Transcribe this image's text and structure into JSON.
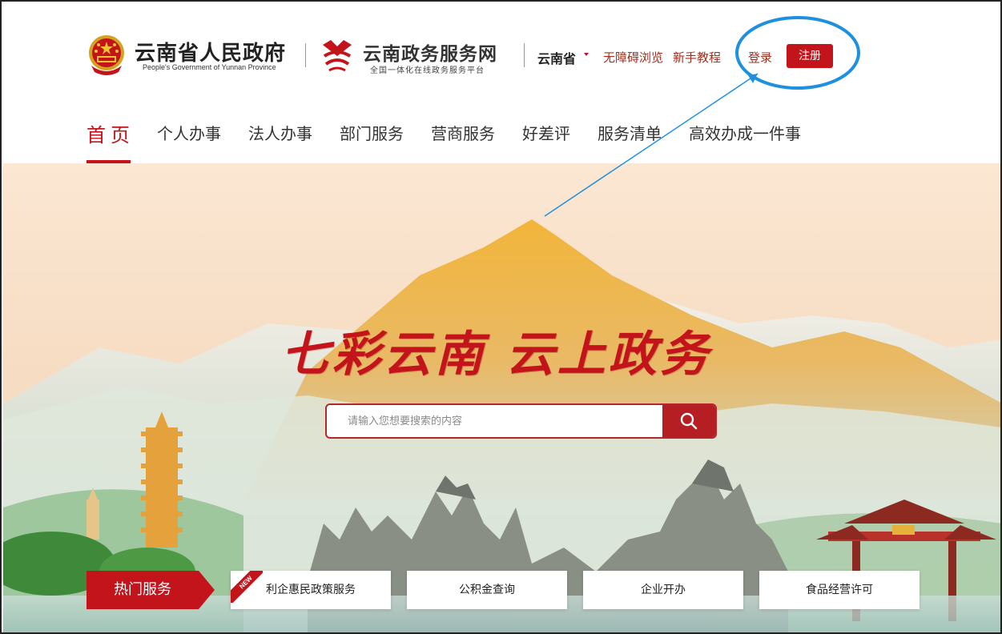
{
  "header": {
    "gov_title": "云南省人民政府",
    "gov_subtitle": "People's Government of Yunnan Province",
    "service_title": "云南政务服务网",
    "service_subtitle": "全国一体化在线政务服务平台",
    "region": "云南省",
    "accessibility_link": "无障碍浏览",
    "tutorial_link": "新手教程",
    "login_label": "登录",
    "register_label": "注册"
  },
  "nav": {
    "items": [
      {
        "label": "首页",
        "active": true
      },
      {
        "label": "个人办事"
      },
      {
        "label": "法人办事"
      },
      {
        "label": "部门服务"
      },
      {
        "label": "营商服务"
      },
      {
        "label": "好差评"
      },
      {
        "label": "服务清单"
      },
      {
        "label": "高效办成一件事"
      }
    ]
  },
  "hero": {
    "slogan": "七彩云南 云上政务",
    "search_placeholder": "请输入您想要搜索的内容",
    "search_icon": "search-icon"
  },
  "hot_services": {
    "label": "热门服务",
    "badge": "NEW",
    "items": [
      "利企惠民政策服务",
      "公积金查询",
      "企业开办",
      "食品经营许可"
    ]
  },
  "colors": {
    "brand_red": "#c3141c",
    "link_brown": "#a2301f",
    "annotation_blue": "#1e90e0"
  }
}
